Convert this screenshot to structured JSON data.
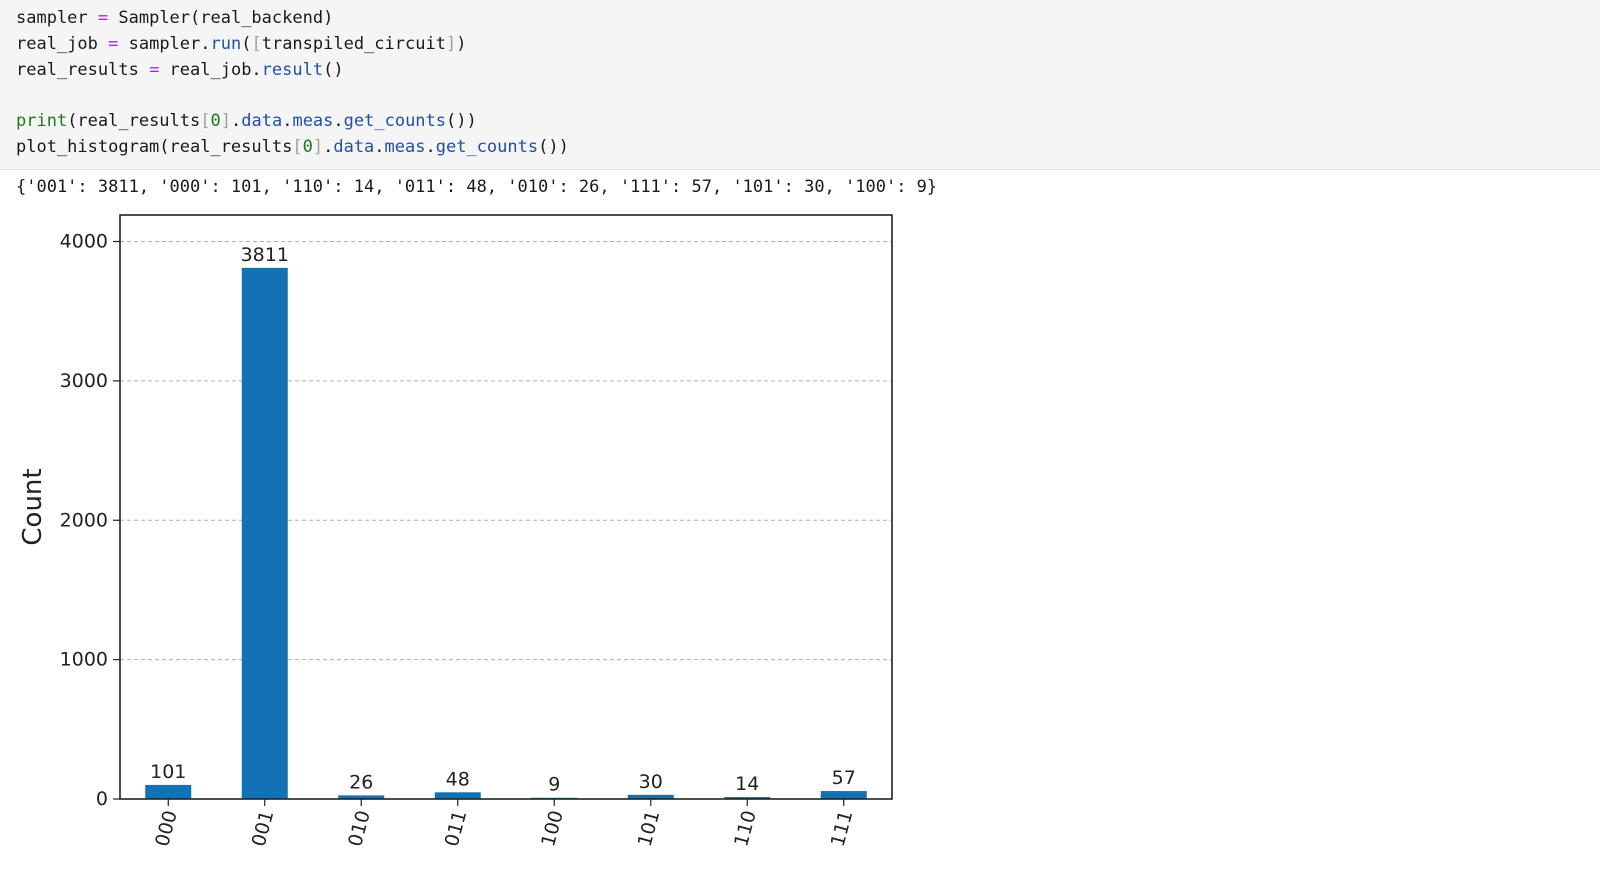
{
  "code_cell": {
    "lines": [
      [
        {
          "t": "sampler",
          "c": ""
        },
        {
          "t": " = ",
          "c": "op"
        },
        {
          "t": "Sampler(real_backend)",
          "c": ""
        }
      ],
      [
        {
          "t": "real_job",
          "c": ""
        },
        {
          "t": " = ",
          "c": "op"
        },
        {
          "t": "sampler.",
          "c": ""
        },
        {
          "t": "run",
          "c": "attr"
        },
        {
          "t": "(",
          "c": ""
        },
        {
          "t": "[",
          "c": "br"
        },
        {
          "t": "transpiled_circuit",
          "c": ""
        },
        {
          "t": "]",
          "c": "br"
        },
        {
          "t": ")",
          "c": ""
        }
      ],
      [
        {
          "t": "real_results",
          "c": ""
        },
        {
          "t": " = ",
          "c": "op"
        },
        {
          "t": "real_job.",
          "c": ""
        },
        {
          "t": "result",
          "c": "attr"
        },
        {
          "t": "()",
          "c": ""
        }
      ],
      [],
      [
        {
          "t": "print",
          "c": "fn"
        },
        {
          "t": "(real_results",
          "c": ""
        },
        {
          "t": "[",
          "c": "br"
        },
        {
          "t": "0",
          "c": "num"
        },
        {
          "t": "]",
          "c": "br"
        },
        {
          "t": ".",
          "c": ""
        },
        {
          "t": "data",
          "c": "attr"
        },
        {
          "t": ".",
          "c": ""
        },
        {
          "t": "meas",
          "c": "attr"
        },
        {
          "t": ".",
          "c": ""
        },
        {
          "t": "get_counts",
          "c": "attr"
        },
        {
          "t": "())",
          "c": ""
        }
      ],
      [
        {
          "t": "plot_histogram(real_results",
          "c": ""
        },
        {
          "t": "[",
          "c": "br"
        },
        {
          "t": "0",
          "c": "num"
        },
        {
          "t": "]",
          "c": "br"
        },
        {
          "t": ".",
          "c": ""
        },
        {
          "t": "data",
          "c": "attr"
        },
        {
          "t": ".",
          "c": ""
        },
        {
          "t": "meas",
          "c": "attr"
        },
        {
          "t": ".",
          "c": ""
        },
        {
          "t": "get_counts",
          "c": "attr"
        },
        {
          "t": "())",
          "c": ""
        }
      ]
    ]
  },
  "output": {
    "printed_counts": "{'001': 3811, '000': 101, '110': 14, '011': 48, '010': 26, '111': 57, '101': 30, '100': 9}"
  },
  "colors": {
    "bar": "#1272b4",
    "grid": "#b0b0b0",
    "axis": "#222222",
    "code_background": "#f5f5f5"
  },
  "chart_data": {
    "type": "bar",
    "categories": [
      "000",
      "001",
      "010",
      "011",
      "100",
      "101",
      "110",
      "111"
    ],
    "values": [
      101,
      3811,
      26,
      48,
      9,
      30,
      14,
      57
    ],
    "data_labels": [
      "101",
      "3811",
      "26",
      "48",
      "9",
      "30",
      "14",
      "57"
    ],
    "title": "",
    "xlabel": "",
    "ylabel": "Count",
    "ylim": [
      0,
      4200
    ],
    "yticks": [
      0,
      1000,
      2000,
      3000,
      4000
    ],
    "ytick_labels": [
      "0",
      "1000",
      "2000",
      "3000",
      "4000"
    ],
    "xtick_rotation": "rotated",
    "grid": "horizontal-dashed",
    "legend": "none"
  }
}
